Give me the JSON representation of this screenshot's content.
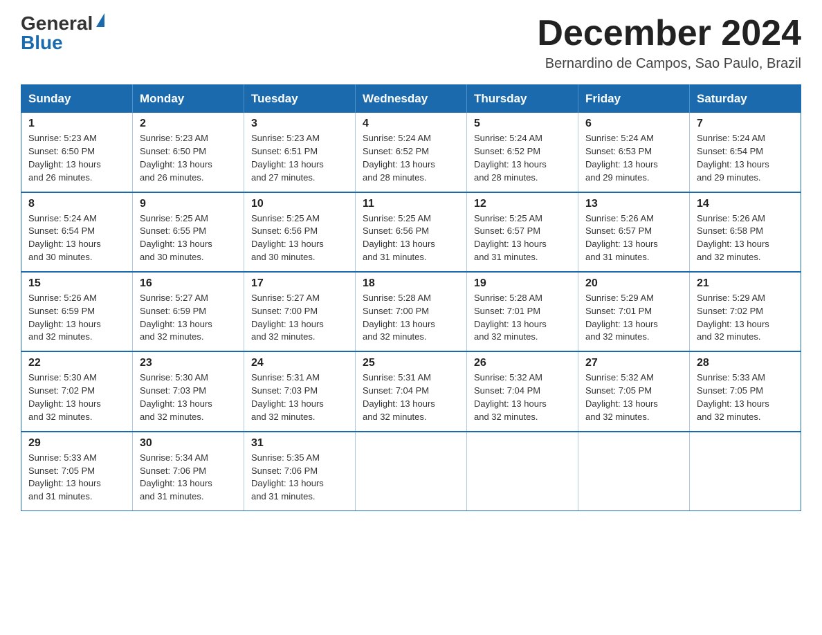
{
  "logo": {
    "general": "General",
    "blue": "Blue"
  },
  "title": "December 2024",
  "location": "Bernardino de Campos, Sao Paulo, Brazil",
  "header_days": [
    "Sunday",
    "Monday",
    "Tuesday",
    "Wednesday",
    "Thursday",
    "Friday",
    "Saturday"
  ],
  "weeks": [
    [
      {
        "day": "1",
        "sunrise": "5:23 AM",
        "sunset": "6:50 PM",
        "daylight": "13 hours and 26 minutes."
      },
      {
        "day": "2",
        "sunrise": "5:23 AM",
        "sunset": "6:50 PM",
        "daylight": "13 hours and 26 minutes."
      },
      {
        "day": "3",
        "sunrise": "5:23 AM",
        "sunset": "6:51 PM",
        "daylight": "13 hours and 27 minutes."
      },
      {
        "day": "4",
        "sunrise": "5:24 AM",
        "sunset": "6:52 PM",
        "daylight": "13 hours and 28 minutes."
      },
      {
        "day": "5",
        "sunrise": "5:24 AM",
        "sunset": "6:52 PM",
        "daylight": "13 hours and 28 minutes."
      },
      {
        "day": "6",
        "sunrise": "5:24 AM",
        "sunset": "6:53 PM",
        "daylight": "13 hours and 29 minutes."
      },
      {
        "day": "7",
        "sunrise": "5:24 AM",
        "sunset": "6:54 PM",
        "daylight": "13 hours and 29 minutes."
      }
    ],
    [
      {
        "day": "8",
        "sunrise": "5:24 AM",
        "sunset": "6:54 PM",
        "daylight": "13 hours and 30 minutes."
      },
      {
        "day": "9",
        "sunrise": "5:25 AM",
        "sunset": "6:55 PM",
        "daylight": "13 hours and 30 minutes."
      },
      {
        "day": "10",
        "sunrise": "5:25 AM",
        "sunset": "6:56 PM",
        "daylight": "13 hours and 30 minutes."
      },
      {
        "day": "11",
        "sunrise": "5:25 AM",
        "sunset": "6:56 PM",
        "daylight": "13 hours and 31 minutes."
      },
      {
        "day": "12",
        "sunrise": "5:25 AM",
        "sunset": "6:57 PM",
        "daylight": "13 hours and 31 minutes."
      },
      {
        "day": "13",
        "sunrise": "5:26 AM",
        "sunset": "6:57 PM",
        "daylight": "13 hours and 31 minutes."
      },
      {
        "day": "14",
        "sunrise": "5:26 AM",
        "sunset": "6:58 PM",
        "daylight": "13 hours and 32 minutes."
      }
    ],
    [
      {
        "day": "15",
        "sunrise": "5:26 AM",
        "sunset": "6:59 PM",
        "daylight": "13 hours and 32 minutes."
      },
      {
        "day": "16",
        "sunrise": "5:27 AM",
        "sunset": "6:59 PM",
        "daylight": "13 hours and 32 minutes."
      },
      {
        "day": "17",
        "sunrise": "5:27 AM",
        "sunset": "7:00 PM",
        "daylight": "13 hours and 32 minutes."
      },
      {
        "day": "18",
        "sunrise": "5:28 AM",
        "sunset": "7:00 PM",
        "daylight": "13 hours and 32 minutes."
      },
      {
        "day": "19",
        "sunrise": "5:28 AM",
        "sunset": "7:01 PM",
        "daylight": "13 hours and 32 minutes."
      },
      {
        "day": "20",
        "sunrise": "5:29 AM",
        "sunset": "7:01 PM",
        "daylight": "13 hours and 32 minutes."
      },
      {
        "day": "21",
        "sunrise": "5:29 AM",
        "sunset": "7:02 PM",
        "daylight": "13 hours and 32 minutes."
      }
    ],
    [
      {
        "day": "22",
        "sunrise": "5:30 AM",
        "sunset": "7:02 PM",
        "daylight": "13 hours and 32 minutes."
      },
      {
        "day": "23",
        "sunrise": "5:30 AM",
        "sunset": "7:03 PM",
        "daylight": "13 hours and 32 minutes."
      },
      {
        "day": "24",
        "sunrise": "5:31 AM",
        "sunset": "7:03 PM",
        "daylight": "13 hours and 32 minutes."
      },
      {
        "day": "25",
        "sunrise": "5:31 AM",
        "sunset": "7:04 PM",
        "daylight": "13 hours and 32 minutes."
      },
      {
        "day": "26",
        "sunrise": "5:32 AM",
        "sunset": "7:04 PM",
        "daylight": "13 hours and 32 minutes."
      },
      {
        "day": "27",
        "sunrise": "5:32 AM",
        "sunset": "7:05 PM",
        "daylight": "13 hours and 32 minutes."
      },
      {
        "day": "28",
        "sunrise": "5:33 AM",
        "sunset": "7:05 PM",
        "daylight": "13 hours and 32 minutes."
      }
    ],
    [
      {
        "day": "29",
        "sunrise": "5:33 AM",
        "sunset": "7:05 PM",
        "daylight": "13 hours and 31 minutes."
      },
      {
        "day": "30",
        "sunrise": "5:34 AM",
        "sunset": "7:06 PM",
        "daylight": "13 hours and 31 minutes."
      },
      {
        "day": "31",
        "sunrise": "5:35 AM",
        "sunset": "7:06 PM",
        "daylight": "13 hours and 31 minutes."
      },
      null,
      null,
      null,
      null
    ]
  ],
  "labels": {
    "sunrise": "Sunrise:",
    "sunset": "Sunset:",
    "daylight": "Daylight:"
  }
}
